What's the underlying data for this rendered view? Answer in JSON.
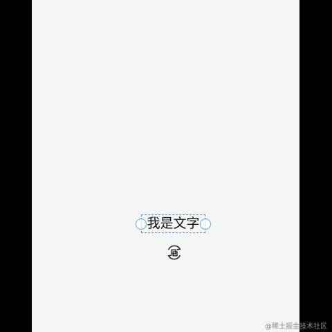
{
  "editor": {
    "text_element": {
      "text": "我是文字"
    },
    "rotate_control": {
      "icon": "rotate-icon"
    }
  },
  "watermark": {
    "text": "@稀土掘金技术社区"
  },
  "colors": {
    "outer_background": "#000000",
    "canvas_background": "#f4f5f5",
    "selection_border": "#4f8fd6",
    "handle_border": "#62a8e8",
    "text": "#111111",
    "watermark": "#8c8c8c"
  }
}
